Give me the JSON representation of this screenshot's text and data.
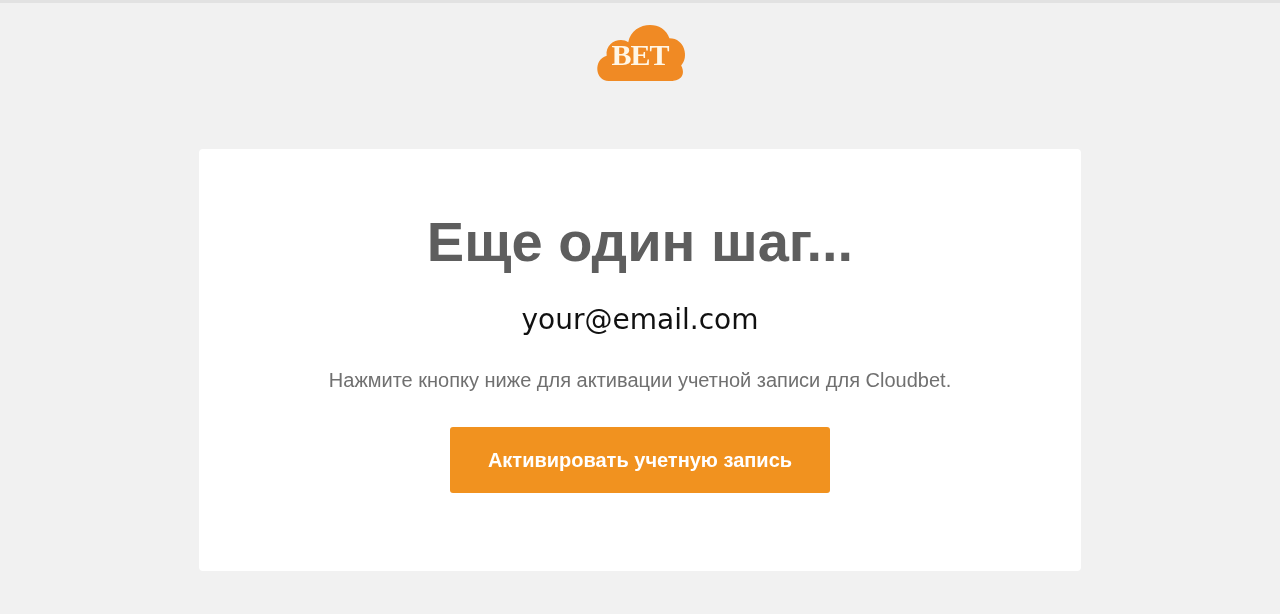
{
  "logo": {
    "text": "BET"
  },
  "card": {
    "heading": "Еще один шаг...",
    "email": "your@email.com",
    "message": "Нажмите кнопку ниже для активации учетной записи для Cloudbet.",
    "button": "Активировать учетную запись"
  }
}
